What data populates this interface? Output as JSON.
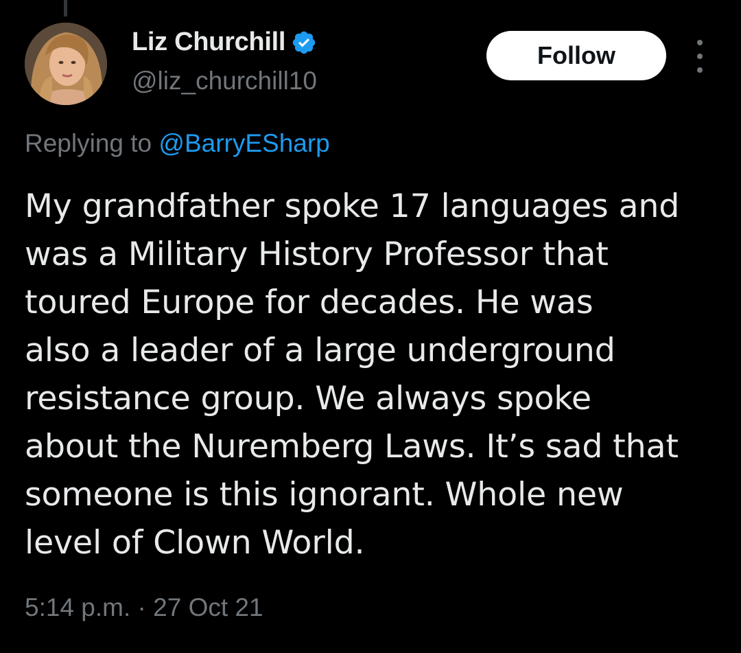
{
  "author": {
    "display_name": "Liz Churchill",
    "handle": "@liz_churchill10",
    "verified": true,
    "avatar_icon": "avatar-photo"
  },
  "actions": {
    "follow_label": "Follow",
    "more_icon": "more-vertical-icon"
  },
  "reply": {
    "prefix": "Replying to ",
    "mention": "@BarryESharp"
  },
  "tweet": {
    "text": "My grandfather spoke 17 languages and\nwas a Military History Professor that\ntoured Europe for decades. He was\nalso a leader of a large underground\nresistance group. We always spoke\nabout the Nuremberg Laws. It’s sad that\nsomeone is this ignorant. Whole new\nlevel of Clown World.",
    "timestamp": "5:14 p.m. · 27 Oct 21"
  },
  "colors": {
    "background": "#000000",
    "primary_text": "#e7e9ea",
    "secondary_text": "#71767b",
    "link": "#1d9bf0",
    "verified_badge": "#1d9bf0",
    "follow_button_bg": "#ffffff"
  }
}
